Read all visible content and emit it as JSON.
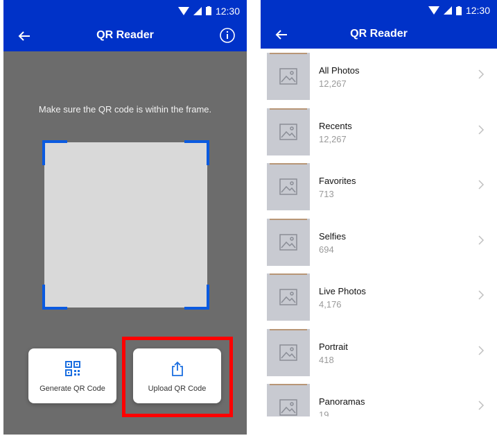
{
  "screen1": {
    "status": {
      "time": "12:30"
    },
    "app_title": "QR Reader",
    "instruction": "Make sure the QR code is within the frame.",
    "buttons": {
      "generate_label": "Generate QR Code",
      "upload_label": "Upload QR Code"
    },
    "colors": {
      "bar": "#0032c8",
      "background": "#6c6c6c",
      "frame_corner": "#0a5ae0",
      "highlight": "#ff0000"
    }
  },
  "screen2": {
    "status": {
      "time": "12:30"
    },
    "app_title": "QR Reader",
    "albums": [
      {
        "name": "All Photos",
        "count": "12,267"
      },
      {
        "name": "Recents",
        "count": "12,267"
      },
      {
        "name": "Favorites",
        "count": "713"
      },
      {
        "name": "Selfies",
        "count": "694"
      },
      {
        "name": "Live Photos",
        "count": "4,176"
      },
      {
        "name": "Portrait",
        "count": "418"
      },
      {
        "name": "Panoramas",
        "count": "19"
      }
    ]
  }
}
